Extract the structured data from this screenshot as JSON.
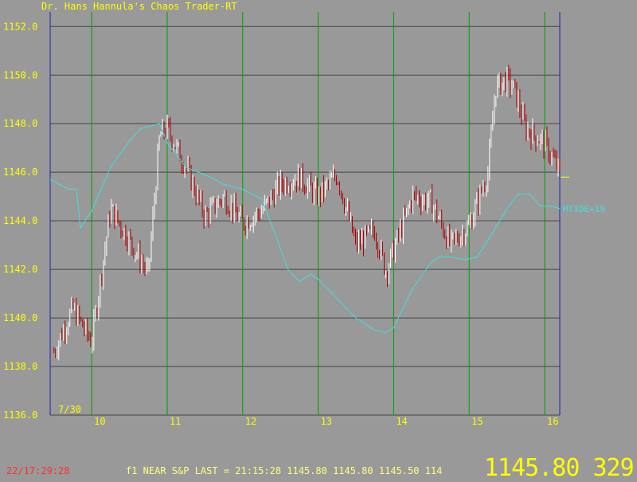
{
  "app_title": "Dr. Hans Hannula's Chaos Trader-RT",
  "status": {
    "clock": "22/17:29:28",
    "feed": "f1 NEAR S&P  LAST = 21:15:28 1145.80 1145.80 1145.50 114",
    "big_readout": "1145.80 329.0"
  },
  "colors": {
    "background": "#999999",
    "axis_text": "#ffff00",
    "grid_h": "#444444",
    "grid_v": "#00a000",
    "bar_up": "#ffffff",
    "bar_down": "#b00000",
    "tide": "#40e0e0",
    "axis_line": "#2020c0"
  },
  "chart_data": {
    "type": "line",
    "title": "",
    "xlabel": "",
    "ylabel": "",
    "date_label": "7/30",
    "ylim": [
      1136.0,
      1152.6
    ],
    "xlim": [
      9.45,
      16.2
    ],
    "y_ticks": [
      "1152.0",
      "1150.0",
      "1148.0",
      "1146.0",
      "1144.0",
      "1142.0",
      "1140.0",
      "1138.0",
      "1136.0"
    ],
    "x_ticks": [
      "10",
      "11",
      "12",
      "13",
      "14",
      "15",
      "16"
    ],
    "grid": true,
    "last_price_marker": 1145.8,
    "price_series": {
      "x": [
        9.5,
        9.75,
        10.0,
        10.25,
        10.5,
        10.75,
        10.9,
        11.0,
        11.25,
        11.5,
        11.75,
        12.0,
        12.25,
        12.5,
        12.75,
        13.0,
        13.25,
        13.5,
        13.75,
        13.9,
        14.0,
        14.25,
        14.5,
        14.75,
        15.0,
        15.25,
        15.35,
        15.5,
        15.6,
        15.75,
        16.0,
        16.2
      ],
      "y": [
        1138.6,
        1140.4,
        1139.0,
        1144.5,
        1143.2,
        1141.8,
        1147.5,
        1147.8,
        1146.2,
        1144.2,
        1145.0,
        1143.9,
        1144.4,
        1145.5,
        1145.8,
        1145.0,
        1145.9,
        1143.0,
        1143.6,
        1141.9,
        1142.8,
        1145.0,
        1144.8,
        1143.0,
        1143.8,
        1146.0,
        1149.5,
        1149.8,
        1149.4,
        1147.8,
        1147.2,
        1146.0
      ]
    },
    "series": [
      {
        "name": "MTIDE+19",
        "x": [
          9.45,
          9.7,
          9.8,
          9.85,
          10.0,
          10.25,
          10.5,
          10.65,
          10.9,
          11.0,
          11.25,
          11.5,
          11.75,
          12.0,
          12.25,
          12.4,
          12.6,
          12.75,
          12.9,
          13.0,
          13.25,
          13.5,
          13.75,
          13.9,
          14.0,
          14.25,
          14.5,
          14.6,
          14.75,
          14.95,
          15.1,
          15.25,
          15.5,
          15.65,
          15.8,
          15.95,
          16.1,
          16.2
        ],
        "y": [
          1145.7,
          1145.3,
          1145.3,
          1143.7,
          1144.4,
          1146.2,
          1147.3,
          1147.8,
          1148.0,
          1147.2,
          1146.2,
          1145.9,
          1145.5,
          1145.3,
          1144.9,
          1143.7,
          1142.0,
          1141.5,
          1141.8,
          1141.6,
          1140.8,
          1140.0,
          1139.5,
          1139.4,
          1139.6,
          1141.2,
          1142.3,
          1142.5,
          1142.5,
          1142.4,
          1142.5,
          1143.2,
          1144.5,
          1145.1,
          1145.1,
          1144.6,
          1144.6,
          1144.5
        ]
      }
    ]
  }
}
